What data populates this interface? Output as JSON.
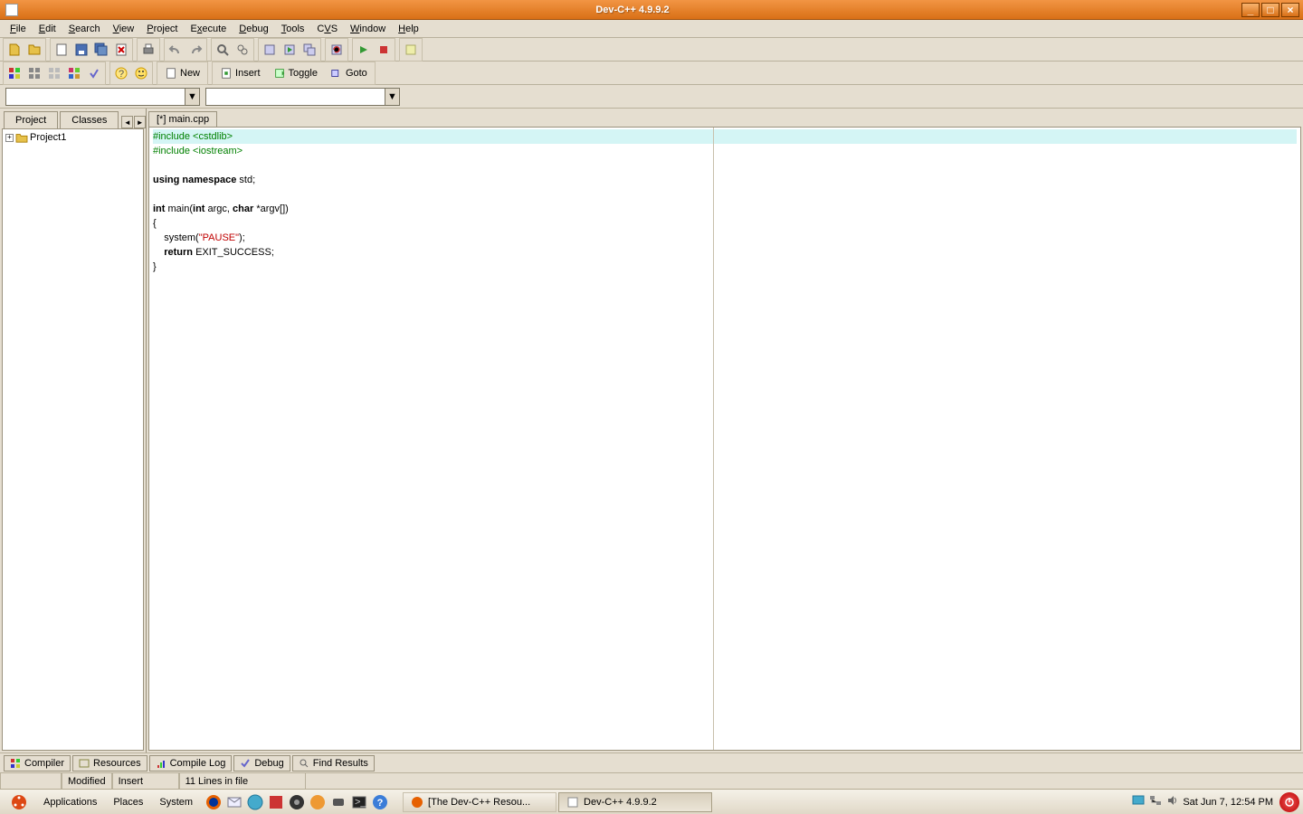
{
  "titlebar": {
    "title": "Dev-C++ 4.9.9.2"
  },
  "menu": [
    "File",
    "Edit",
    "Search",
    "View",
    "Project",
    "Execute",
    "Debug",
    "Tools",
    "CVS",
    "Window",
    "Help"
  ],
  "toolbar2": {
    "new": "New",
    "insert": "Insert",
    "toggle": "Toggle",
    "goto": "Goto"
  },
  "left": {
    "tabs": [
      "Project",
      "Classes"
    ],
    "project": "Project1"
  },
  "file_tab": "[*] main.cpp",
  "code": {
    "l1a": "#include ",
    "l1b": "<cstdlib>",
    "l2a": "#include ",
    "l2b": "<iostream>",
    "l3": "",
    "l4a": "using",
    "l4b": " ",
    "l4c": "namespace",
    "l4d": " std;",
    "l5": "",
    "l6a": "int",
    "l6b": " main(",
    "l6c": "int",
    "l6d": " argc, ",
    "l6e": "char",
    "l6f": " *argv[])",
    "l7": "{",
    "l8a": "    system(",
    "l8b": "\"PAUSE\"",
    "l8c": ");",
    "l9a": "    ",
    "l9b": "return",
    "l9c": " EXIT_SUCCESS;",
    "l10": "}"
  },
  "bottom_tabs": [
    "Compiler",
    "Resources",
    "Compile Log",
    "Debug",
    "Find Results"
  ],
  "status": {
    "modified": "Modified",
    "insert": "Insert",
    "lines": "11 Lines in file"
  },
  "taskbar": {
    "applications": "Applications",
    "places": "Places",
    "system": "System",
    "task1": "[The Dev-C++ Resou...",
    "task2": "Dev-C++ 4.9.9.2",
    "clock": "Sat Jun  7, 12:54 PM"
  }
}
